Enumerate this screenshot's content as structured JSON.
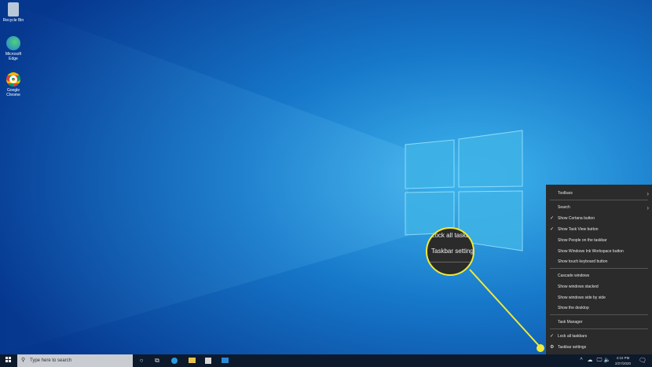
{
  "desktop": {
    "icons": [
      {
        "label": "Recycle Bin"
      },
      {
        "label": "Microsoft Edge"
      },
      {
        "label": "Google Chrome"
      }
    ]
  },
  "context_menu": {
    "items": [
      {
        "label": "Toolbars",
        "submenu": true
      },
      {
        "label": "Search",
        "submenu": true
      },
      {
        "label": "Show Cortana button",
        "checked": true
      },
      {
        "label": "Show Task View button",
        "checked": true
      },
      {
        "label": "Show People on the taskbar"
      },
      {
        "label": "Show Windows Ink Workspace button"
      },
      {
        "label": "Show touch keyboard button"
      },
      {
        "label": "Cascade windows"
      },
      {
        "label": "Show windows stacked"
      },
      {
        "label": "Show windows side by side"
      },
      {
        "label": "Show the desktop"
      },
      {
        "label": "Task Manager"
      },
      {
        "label": "Lock all taskbars",
        "checked": true
      },
      {
        "label": "Taskbar settings",
        "icon": "gear-icon"
      }
    ],
    "check": "✓",
    "arrow": "›",
    "gear": "⚙"
  },
  "callout": {
    "line1": "Lock all taskbars",
    "line2": "Taskbar settings",
    "color": "#f0ea3a"
  },
  "taskbar": {
    "search_placeholder": "Type here to search",
    "time": "4:10 PM",
    "date": "2/27/2020"
  }
}
